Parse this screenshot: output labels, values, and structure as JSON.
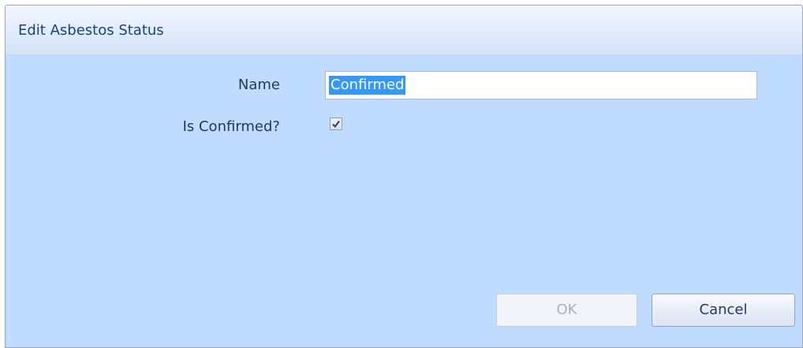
{
  "window": {
    "title": "Edit Asbestos Status"
  },
  "form": {
    "name_label": "Name",
    "name_value": "Confirmed",
    "confirmed_label": "Is Confirmed?",
    "confirmed_checked": true
  },
  "buttons": {
    "ok_label": "OK",
    "cancel_label": "Cancel"
  },
  "colors": {
    "background": "#bfdbff",
    "title_text": "#15428b",
    "selection": "#3399ff"
  },
  "icons": {
    "checkbox": "check-icon"
  }
}
